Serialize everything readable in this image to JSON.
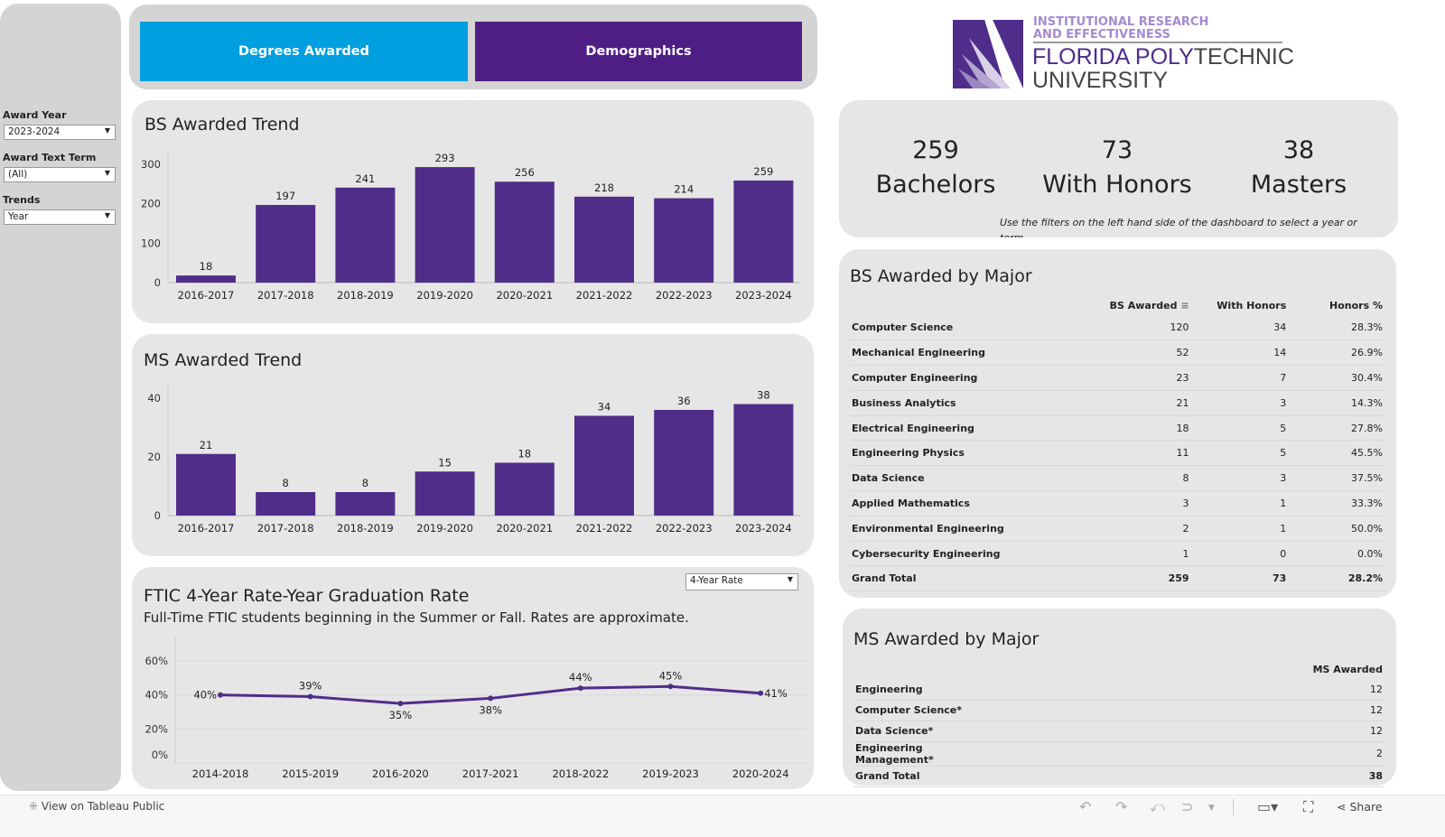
{
  "sidebar": {
    "filters": [
      {
        "label": "Award Year",
        "value": "2023-2024"
      },
      {
        "label": "Award Text Term",
        "value": "(All)"
      },
      {
        "label": "Trends",
        "value": "Year"
      }
    ]
  },
  "nav": {
    "degrees_awarded": "Degrees Awarded",
    "demographics": "Demographics",
    "colors": {
      "degrees": "#009fdf",
      "demographics": "#4f1e85"
    }
  },
  "logo": {
    "line1": "INSTITUTIONAL RESEARCH",
    "line2": "AND EFFECTIVENESS",
    "line3a": "FLORIDA POLY",
    "line3b": "TECHNIC",
    "line4": "UNIVERSITY"
  },
  "kpis": [
    {
      "value": "259",
      "label": "Bachelors"
    },
    {
      "value": "73",
      "label": "With Honors"
    },
    {
      "value": "38",
      "label": "Masters"
    }
  ],
  "kpi_note": "Use the filters on the left hand side of the dashboard to select a year or term",
  "chart_data": [
    {
      "type": "bar",
      "title": "BS Awarded Trend",
      "categories": [
        "2016-2017",
        "2017-2018",
        "2018-2019",
        "2019-2020",
        "2020-2021",
        "2021-2022",
        "2022-2023",
        "2023-2024"
      ],
      "values": [
        18,
        197,
        241,
        293,
        256,
        218,
        214,
        259
      ],
      "yticks": [
        "0",
        "100",
        "200",
        "300"
      ],
      "ylim": [
        0,
        300
      ],
      "color": "#512d8a"
    },
    {
      "type": "bar",
      "title": "MS Awarded Trend",
      "categories": [
        "2016-2017",
        "2017-2018",
        "2018-2019",
        "2019-2020",
        "2020-2021",
        "2021-2022",
        "2022-2023",
        "2023-2024"
      ],
      "values": [
        21,
        8,
        8,
        15,
        18,
        34,
        36,
        38
      ],
      "yticks": [
        "0",
        "20",
        "40"
      ],
      "ylim": [
        0,
        40
      ],
      "color": "#512d8a"
    },
    {
      "type": "line",
      "title": "FTIC 4-Year Rate-Year Graduation Rate",
      "subtitle": "Full-Time FTIC students beginning in the Summer or Fall. Rates are approximate.",
      "categories": [
        "2014-2018",
        "2015-2019",
        "2016-2020",
        "2017-2021",
        "2018-2022",
        "2019-2023",
        "2020-2024"
      ],
      "values": [
        40,
        39,
        35,
        38,
        44,
        45,
        41
      ],
      "labels": [
        "40%",
        "39%",
        "35%",
        "38%",
        "44%",
        "45%",
        "41%"
      ],
      "yticks": [
        "0%",
        "20%",
        "40%",
        "60%"
      ],
      "ylim": [
        0,
        60
      ],
      "color": "#512d8a",
      "grid": true
    }
  ],
  "ftic_selector": "4-Year Rate",
  "bs_table": {
    "title": "BS Awarded by Major",
    "headers": [
      "BS Awarded",
      "With Honors",
      "Honors %"
    ],
    "rows": [
      [
        "Computer Science",
        "120",
        "34",
        "28.3%"
      ],
      [
        "Mechanical Engineering",
        "52",
        "14",
        "26.9%"
      ],
      [
        "Computer Engineering",
        "23",
        "7",
        "30.4%"
      ],
      [
        "Business Analytics",
        "21",
        "3",
        "14.3%"
      ],
      [
        "Electrical Engineering",
        "18",
        "5",
        "27.8%"
      ],
      [
        "Engineering Physics",
        "11",
        "5",
        "45.5%"
      ],
      [
        "Data Science",
        "8",
        "3",
        "37.5%"
      ],
      [
        "Applied Mathematics",
        "3",
        "1",
        "33.3%"
      ],
      [
        "Environmental Engineering",
        "2",
        "1",
        "50.0%"
      ],
      [
        "Cybersecurity Engineering",
        "1",
        "0",
        "0.0%"
      ],
      [
        "Grand Total",
        "259",
        "73",
        "28.2%"
      ]
    ]
  },
  "ms_table": {
    "title": "MS Awarded by Major",
    "header": "MS Awarded",
    "rows": [
      [
        "Engineering",
        "12"
      ],
      [
        "Computer Science*",
        "12"
      ],
      [
        "Data Science*",
        "12"
      ],
      [
        "Engineering Management*",
        "2"
      ],
      [
        "Grand Total",
        "38"
      ]
    ]
  },
  "footer": {
    "view_link": "View on Tableau Public",
    "share": "Share"
  }
}
